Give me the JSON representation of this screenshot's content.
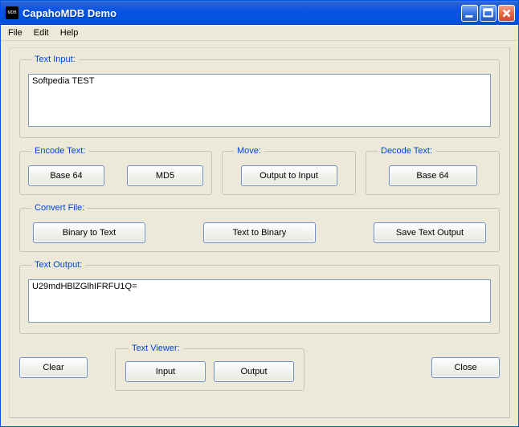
{
  "window": {
    "title": "CapahoMDB Demo"
  },
  "menu": {
    "file": "File",
    "edit": "Edit",
    "help": "Help"
  },
  "groups": {
    "text_input": "Text Input:",
    "encode": "Encode Text:",
    "move": "Move:",
    "decode": "Decode Text:",
    "convert": "Convert File:",
    "text_output": "Text Output:",
    "viewer": "Text Viewer:"
  },
  "inputs": {
    "text_input_value": "Softpedia TEST",
    "text_output_value": "U29mdHBlZGlhIFRFU1Q="
  },
  "buttons": {
    "base64": "Base 64",
    "md5": "MD5",
    "output_to_input": "Output to Input",
    "decode_base64": "Base 64",
    "binary_to_text": "Binary to Text",
    "text_to_binary": "Text to Binary",
    "save_text_output": "Save Text Output",
    "clear": "Clear",
    "input": "Input",
    "output": "Output",
    "close": "Close"
  }
}
